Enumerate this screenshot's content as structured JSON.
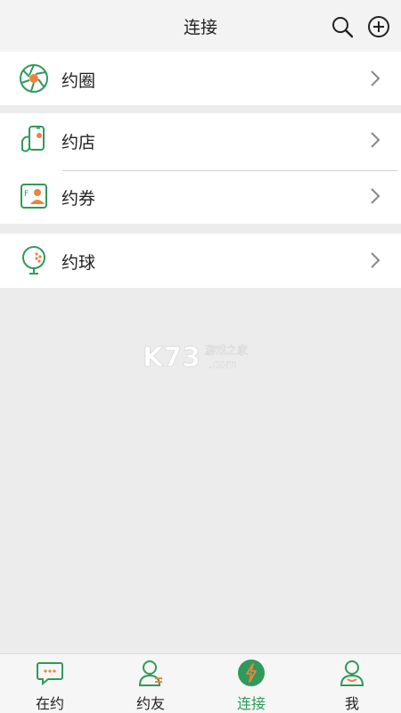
{
  "header": {
    "title": "连接",
    "search_icon": "search-icon",
    "add_icon": "plus-circle-icon"
  },
  "groups": [
    {
      "items": [
        {
          "label": "约圈",
          "icon": "aperture-icon"
        }
      ]
    },
    {
      "items": [
        {
          "label": "约店",
          "icon": "phone-hand-icon"
        },
        {
          "label": "约券",
          "icon": "coupon-icon"
        }
      ]
    },
    {
      "items": [
        {
          "label": "约球",
          "icon": "golf-ball-icon"
        }
      ]
    }
  ],
  "watermark": {
    "text1": "K73",
    "text2": "游戏之家",
    "text3": ".com"
  },
  "tabs": [
    {
      "label": "在约",
      "icon": "chat-bubble-icon",
      "active": false
    },
    {
      "label": "约友",
      "icon": "person-icon",
      "active": false
    },
    {
      "label": "连接",
      "icon": "lightning-icon",
      "active": true
    },
    {
      "label": "我",
      "icon": "user-icon",
      "active": false
    }
  ],
  "colors": {
    "accent": "#2f9a5c",
    "orange": "#f0823c",
    "background": "#ececec"
  }
}
